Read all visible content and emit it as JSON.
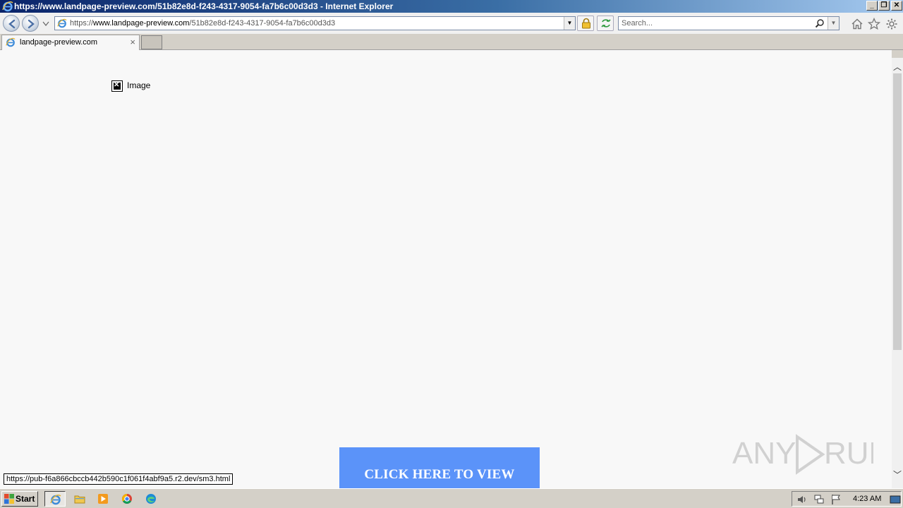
{
  "window": {
    "title": "https://www.landpage-preview.com/51b82e8d-f243-4317-9054-fa7b6c00d3d3 - Internet Explorer",
    "min_symbol": "_",
    "restore_symbol": "❐",
    "close_symbol": "✕"
  },
  "address_bar": {
    "scheme": "https://",
    "host": "www.landpage-preview.com",
    "path": "/51b82e8d-f243-4317-9054-fa7b6c00d3d3"
  },
  "search": {
    "placeholder": "Search..."
  },
  "tabs": [
    {
      "label": "landpage-preview.com",
      "active": true
    }
  ],
  "page": {
    "broken_image_alt": "Image",
    "cta_label": "CLICK HERE TO VIEW",
    "cta_color": "#5b93f9",
    "watermark_text": "ANY RUN"
  },
  "status_bar": {
    "hover_url": "https://pub-f6a866cbccb442b590c1f061f4abf9a5.r2.dev/sm3.html"
  },
  "taskbar": {
    "start_label": "Start",
    "clock": "4:23 AM",
    "apps": [
      "internet-explorer",
      "file-explorer",
      "media-player",
      "chrome",
      "edge"
    ]
  }
}
